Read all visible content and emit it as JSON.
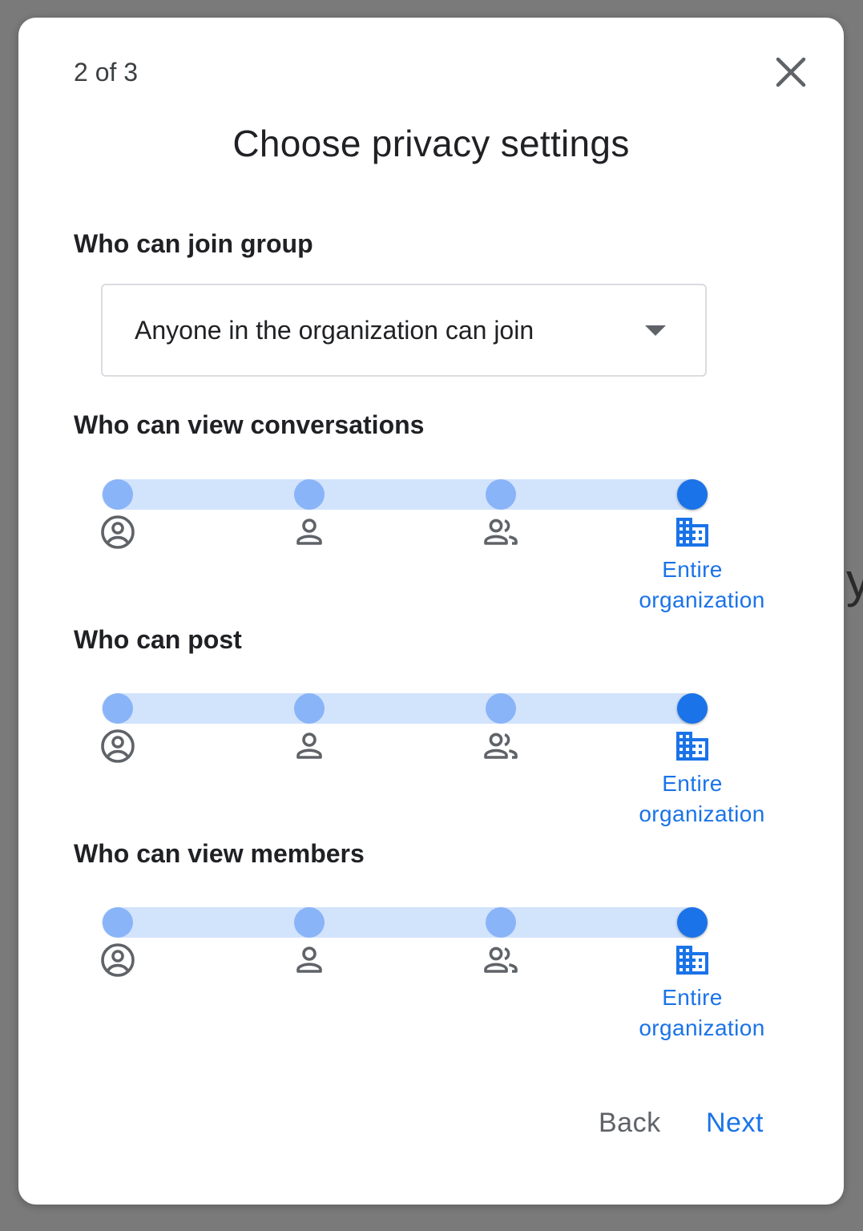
{
  "dialog": {
    "step": "2 of 3",
    "title": "Choose privacy settings",
    "close_label": "Close"
  },
  "join": {
    "label": "Who can join group",
    "selected": "Anyone in the organization can join"
  },
  "view_conversations": {
    "label": "Who can view conversations",
    "selected_label_line1": "Entire",
    "selected_label_line2": "organization",
    "selected_index": 3
  },
  "post": {
    "label": "Who can post",
    "selected_label_line1": "Entire",
    "selected_label_line2": "organization",
    "selected_index": 3
  },
  "view_members": {
    "label": "Who can view members",
    "selected_label_line1": "Entire",
    "selected_label_line2": "organization",
    "selected_index": 3
  },
  "slider_options": [
    "account-circle-icon",
    "person-icon",
    "people-icon",
    "domain-building-icon"
  ],
  "colors": {
    "accent": "#1a73e8",
    "track": "#d2e3fc",
    "stop_inactive": "#8ab4f8",
    "icon_gray": "#5f6368"
  },
  "footer": {
    "back": "Back",
    "next": "Next"
  }
}
